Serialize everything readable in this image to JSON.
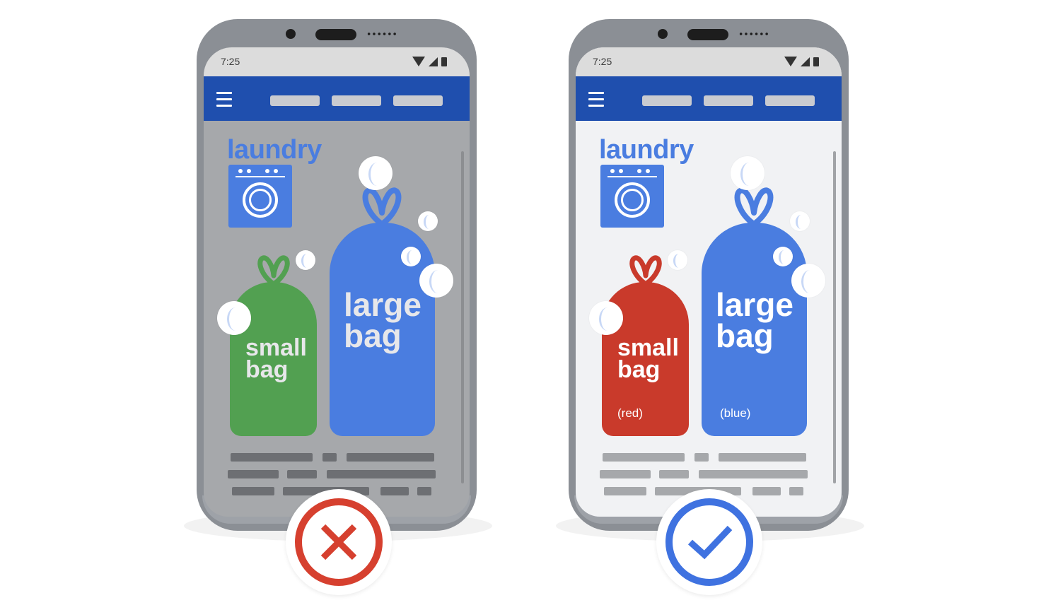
{
  "left_phone": {
    "status_time": "7:25",
    "title": "laundry",
    "small_bag": {
      "line1": "small",
      "line2": "bag",
      "color": "#52a051"
    },
    "large_bag": {
      "line1": "large",
      "line2": "bag",
      "color": "#4a7de0"
    },
    "verdict_icon": "x-mark-icon",
    "verdict_color": "#d6402f"
  },
  "right_phone": {
    "status_time": "7:25",
    "title": "laundry",
    "small_bag": {
      "line1": "small",
      "line2": "bag",
      "note": "(red)",
      "color": "#c93a2b"
    },
    "large_bag": {
      "line1": "large",
      "line2": "bag",
      "note": "(blue)",
      "color": "#4a7de0"
    },
    "verdict_icon": "checkmark-icon",
    "verdict_color": "#3f72e0"
  },
  "colors": {
    "appbar": "#1f4fae",
    "accent_blue": "#4a7de0"
  }
}
